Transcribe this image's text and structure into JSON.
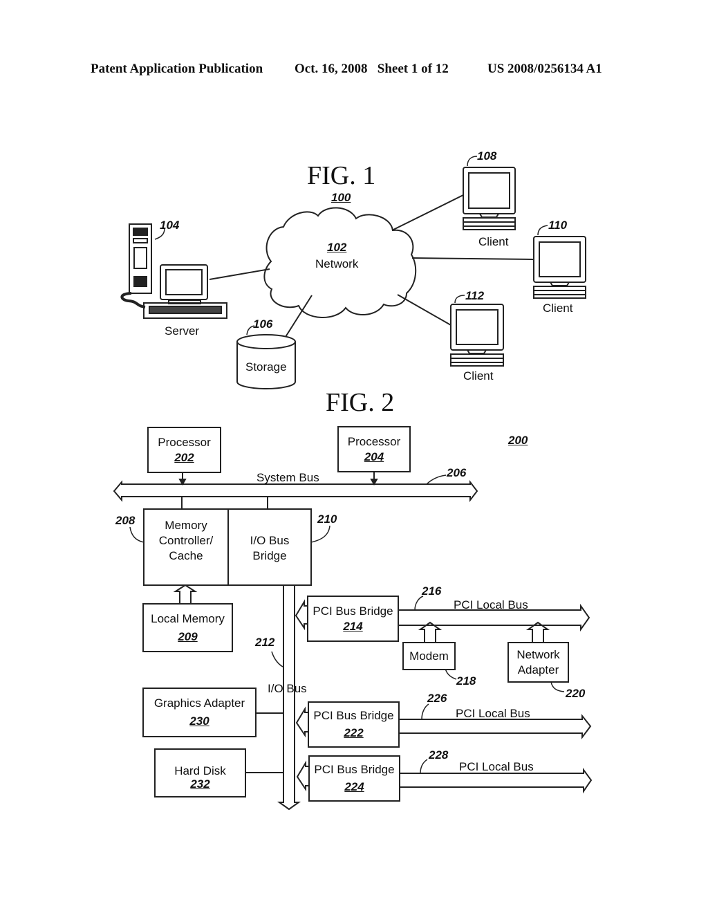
{
  "header": {
    "publication": "Patent Application Publication",
    "date_sheet": "Oct. 16, 2008   Sheet 1 of 12",
    "patent_number": "US 2008/0256134 A1"
  },
  "fig1": {
    "title": "FIG. 1",
    "ref": "100",
    "network": {
      "ref": "102",
      "label": "Network"
    },
    "server": {
      "ref": "104",
      "label": "Server"
    },
    "storage": {
      "ref": "106",
      "label": "Storage"
    },
    "clients": [
      {
        "ref": "108",
        "label": "Client"
      },
      {
        "ref": "110",
        "label": "Client"
      },
      {
        "ref": "112",
        "label": "Client"
      }
    ]
  },
  "fig2": {
    "title": "FIG. 2",
    "ref": "200",
    "processor1": {
      "label": "Processor",
      "ref": "202"
    },
    "processor2": {
      "label": "Processor",
      "ref": "204"
    },
    "system_bus": {
      "label": "System Bus",
      "ref": "206"
    },
    "memory_controller": {
      "line1": "Memory",
      "line2": "Controller/",
      "line3": "Cache",
      "ref": "208"
    },
    "io_bus_bridge": {
      "line1": "I/O Bus",
      "line2": "Bridge",
      "ref": "210"
    },
    "local_memory": {
      "label": "Local Memory",
      "ref": "209"
    },
    "io_bus": {
      "label": "I/O Bus",
      "ref": "212"
    },
    "pci_bridge_214": {
      "label": "PCI Bus Bridge",
      "ref": "214"
    },
    "pci_local_bus_216": {
      "label": "PCI Local Bus",
      "ref": "216"
    },
    "modem": {
      "label": "Modem",
      "ref": "218"
    },
    "network_adapter": {
      "line1": "Network",
      "line2": "Adapter",
      "ref": "220"
    },
    "graphics_adapter": {
      "label": "Graphics Adapter",
      "ref": "230"
    },
    "pci_bridge_222": {
      "label": "PCI Bus Bridge",
      "ref": "222"
    },
    "pci_local_bus_226": {
      "label": "PCI Local Bus",
      "ref": "226"
    },
    "hard_disk": {
      "label": "Hard Disk",
      "ref": "232"
    },
    "pci_bridge_224": {
      "label": "PCI Bus Bridge",
      "ref": "224"
    },
    "pci_local_bus_228": {
      "label": "PCI Local Bus",
      "ref": "228"
    }
  }
}
